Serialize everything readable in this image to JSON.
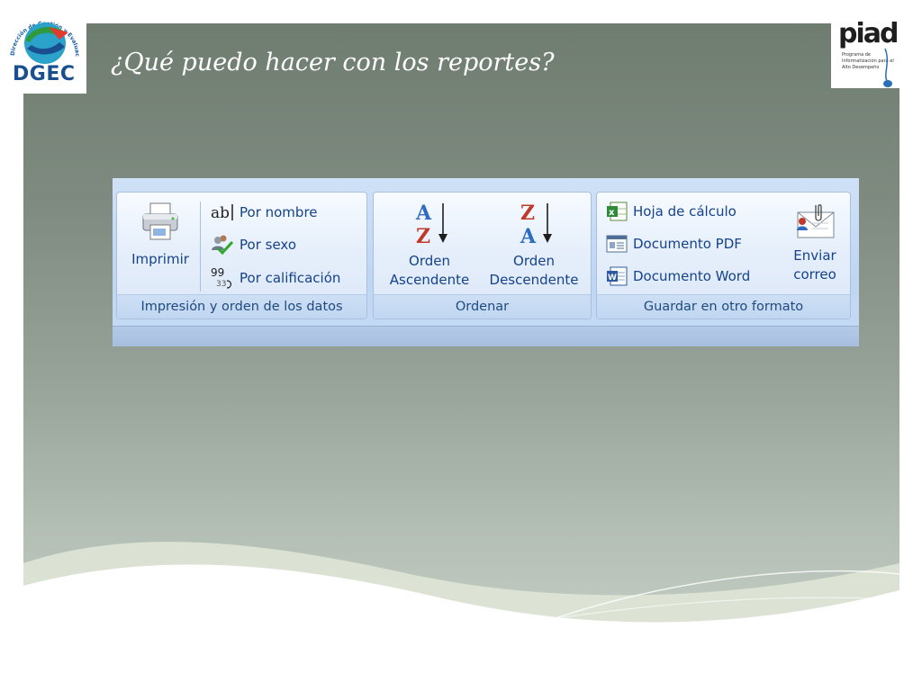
{
  "slide": {
    "title": "¿Qué puedo hacer con los reportes?"
  },
  "logos": {
    "left": {
      "curved_text": "Dirección de Gestión y Evaluación de la Calidad",
      "text": "DGEC"
    },
    "right": {
      "text": "piad",
      "subtitle": "Programa de Informatización para el Alto Desempeño"
    }
  },
  "ribbon": {
    "groups": [
      {
        "label": "Impresión y orden de los datos",
        "big_button": {
          "label": "Imprimir",
          "icon": "printer-icon"
        },
        "small_buttons": [
          {
            "label": "Por nombre",
            "icon": "text-ab-icon"
          },
          {
            "label": "Por sexo",
            "icon": "users-check-icon"
          },
          {
            "label": "Por calificación",
            "icon": "number-sort-icon"
          }
        ]
      },
      {
        "label": "Ordenar",
        "buttons": [
          {
            "line1": "Orden",
            "line2": "Ascendente",
            "icon": "sort-az-icon",
            "glyphs": [
              "A",
              "Z"
            ]
          },
          {
            "line1": "Orden",
            "line2": "Descendente",
            "icon": "sort-za-icon",
            "glyphs": [
              "Z",
              "A"
            ]
          }
        ]
      },
      {
        "label": "Guardar en otro formato",
        "small_buttons": [
          {
            "label": "Hoja de cálculo",
            "icon": "spreadsheet-icon"
          },
          {
            "label": "Documento PDF",
            "icon": "pdf-document-icon"
          },
          {
            "label": "Documento Word",
            "icon": "word-document-icon"
          }
        ],
        "big_button": {
          "line1": "Enviar",
          "line2": "correo",
          "icon": "email-attachment-icon"
        }
      }
    ]
  },
  "colors": {
    "ribbon_text": "#15428b",
    "ribbon_bg": "#c6daf4",
    "slide_bg": "#7f8b80"
  }
}
